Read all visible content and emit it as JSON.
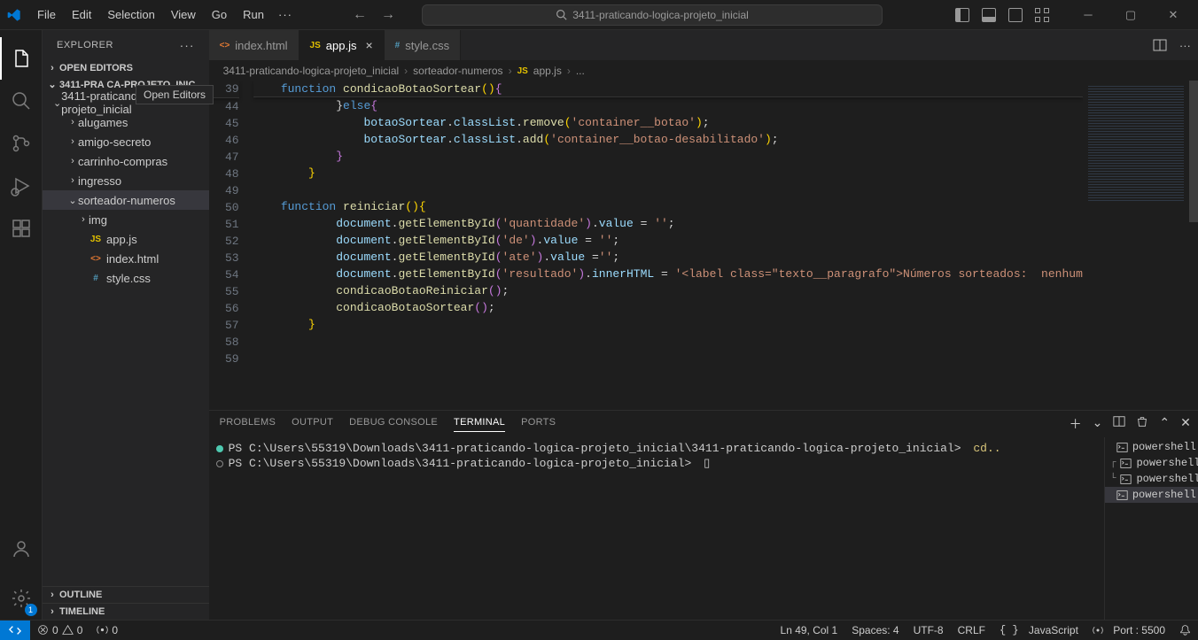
{
  "menubar": [
    "File",
    "Edit",
    "Selection",
    "View",
    "Go",
    "Run"
  ],
  "searchPlaceholder": "3411-praticando-logica-projeto_inicial",
  "explorerTitle": "EXPLORER",
  "sections": {
    "openEditors": "OPEN EDITORS",
    "outline": "OUTLINE",
    "timeline": "TIMELINE"
  },
  "tooltip": "Open Editors",
  "tree": {
    "root": "3411-PRA              CA-PROJETO_INIC...",
    "nodes": [
      {
        "depth": 1,
        "kind": "folder",
        "open": true,
        "label": "3411-praticando-logica-projeto_inicial"
      },
      {
        "depth": 2,
        "kind": "folder",
        "open": false,
        "label": "alugames"
      },
      {
        "depth": 2,
        "kind": "folder",
        "open": false,
        "label": "amigo-secreto"
      },
      {
        "depth": 2,
        "kind": "folder",
        "open": false,
        "label": "carrinho-compras"
      },
      {
        "depth": 2,
        "kind": "folder",
        "open": false,
        "label": "ingresso"
      },
      {
        "depth": 2,
        "kind": "folder",
        "open": true,
        "label": "sorteador-numeros",
        "selected": true
      },
      {
        "depth": 3,
        "kind": "folder",
        "open": false,
        "label": "img"
      },
      {
        "depth": 3,
        "kind": "file",
        "icon": "JS",
        "iconColor": "#e2c000",
        "label": "app.js"
      },
      {
        "depth": 3,
        "kind": "file",
        "icon": "<>",
        "iconColor": "#e37933",
        "label": "index.html"
      },
      {
        "depth": 3,
        "kind": "file",
        "icon": "#",
        "iconColor": "#519aba",
        "label": "style.css"
      }
    ]
  },
  "tabs": [
    {
      "icon": "<>",
      "iconColor": "#e37933",
      "label": "index.html",
      "active": false
    },
    {
      "icon": "JS",
      "iconColor": "#e2c000",
      "label": "app.js",
      "active": true,
      "close": true
    },
    {
      "icon": "#",
      "iconColor": "#519aba",
      "label": "style.css",
      "active": false
    }
  ],
  "breadcrumbs": [
    "3411-praticando-logica-projeto_inicial",
    "sorteador-numeros",
    "app.js",
    "..."
  ],
  "bcIcon": "JS",
  "codeStart": 39,
  "stickyLine": 39,
  "code": [
    [
      {
        "c": "k-blue",
        "t": "function "
      },
      {
        "c": "k-fn",
        "t": "condicaoBotaoSortear"
      },
      {
        "c": "k-brk",
        "t": "()"
      },
      {
        "c": "k-pnk",
        "t": "{"
      }
    ],
    [
      {
        "t": "        }"
      },
      {
        "c": "k-blue",
        "t": "else"
      },
      {
        "c": "k-pnk",
        "t": "{"
      }
    ],
    [
      {
        "t": "            "
      },
      {
        "c": "k-var",
        "t": "botaoSortear"
      },
      {
        "t": "."
      },
      {
        "c": "k-var",
        "t": "classList"
      },
      {
        "t": "."
      },
      {
        "c": "k-fn",
        "t": "remove"
      },
      {
        "c": "k-brk",
        "t": "("
      },
      {
        "c": "k-str",
        "t": "'container__botao'"
      },
      {
        "c": "k-brk",
        "t": ")"
      },
      {
        "t": ";"
      }
    ],
    [
      {
        "t": "            "
      },
      {
        "c": "k-var",
        "t": "botaoSortear"
      },
      {
        "t": "."
      },
      {
        "c": "k-var",
        "t": "classList"
      },
      {
        "t": "."
      },
      {
        "c": "k-fn",
        "t": "add"
      },
      {
        "c": "k-brk",
        "t": "("
      },
      {
        "c": "k-str",
        "t": "'container__botao-desabilitado'"
      },
      {
        "c": "k-brk",
        "t": ")"
      },
      {
        "t": ";"
      }
    ],
    [
      {
        "t": "        "
      },
      {
        "c": "k-pnk",
        "t": "}"
      }
    ],
    [
      {
        "t": "    "
      },
      {
        "c": "k-brk",
        "t": "}"
      }
    ],
    [
      {
        "t": ""
      }
    ],
    [
      {
        "c": "k-blue",
        "t": "function "
      },
      {
        "c": "k-fn",
        "t": "reiniciar"
      },
      {
        "c": "k-brk",
        "t": "()"
      },
      {
        "c": "k-brk",
        "t": "{"
      }
    ],
    [
      {
        "t": "        "
      },
      {
        "c": "k-var",
        "t": "document"
      },
      {
        "t": "."
      },
      {
        "c": "k-fn",
        "t": "getElementById"
      },
      {
        "c": "k-pnk",
        "t": "("
      },
      {
        "c": "k-str",
        "t": "'quantidade'"
      },
      {
        "c": "k-pnk",
        "t": ")"
      },
      {
        "t": "."
      },
      {
        "c": "k-var",
        "t": "value"
      },
      {
        "t": " = "
      },
      {
        "c": "k-str",
        "t": "''"
      },
      {
        "t": ";"
      }
    ],
    [
      {
        "t": "        "
      },
      {
        "c": "k-var",
        "t": "document"
      },
      {
        "t": "."
      },
      {
        "c": "k-fn",
        "t": "getElementById"
      },
      {
        "c": "k-pnk",
        "t": "("
      },
      {
        "c": "k-str",
        "t": "'de'"
      },
      {
        "c": "k-pnk",
        "t": ")"
      },
      {
        "t": "."
      },
      {
        "c": "k-var",
        "t": "value"
      },
      {
        "t": " = "
      },
      {
        "c": "k-str",
        "t": "''"
      },
      {
        "t": ";"
      }
    ],
    [
      {
        "t": "        "
      },
      {
        "c": "k-var",
        "t": "document"
      },
      {
        "t": "."
      },
      {
        "c": "k-fn",
        "t": "getElementById"
      },
      {
        "c": "k-pnk",
        "t": "("
      },
      {
        "c": "k-str",
        "t": "'ate'"
      },
      {
        "c": "k-pnk",
        "t": ")"
      },
      {
        "t": "."
      },
      {
        "c": "k-var",
        "t": "value"
      },
      {
        "t": " ="
      },
      {
        "c": "k-str",
        "t": "''"
      },
      {
        "t": ";"
      }
    ],
    [
      {
        "t": "        "
      },
      {
        "c": "k-var",
        "t": "document"
      },
      {
        "t": "."
      },
      {
        "c": "k-fn",
        "t": "getElementById"
      },
      {
        "c": "k-pnk",
        "t": "("
      },
      {
        "c": "k-str",
        "t": "'resultado'"
      },
      {
        "c": "k-pnk",
        "t": ")"
      },
      {
        "t": "."
      },
      {
        "c": "k-var",
        "t": "innerHTML"
      },
      {
        "t": " = "
      },
      {
        "c": "k-str",
        "t": "'<label class=\"texto__paragrafo\">Números sorteados:  nenhum"
      }
    ],
    [
      {
        "t": "        "
      },
      {
        "c": "k-fn",
        "t": "condicaoBotaoReiniciar"
      },
      {
        "c": "k-pnk",
        "t": "()"
      },
      {
        "t": ";"
      }
    ],
    [
      {
        "t": "        "
      },
      {
        "c": "k-fn",
        "t": "condicaoBotaoSortear"
      },
      {
        "c": "k-pnk",
        "t": "()"
      },
      {
        "t": ";"
      }
    ],
    [
      {
        "t": "    "
      },
      {
        "c": "k-brk",
        "t": "}"
      }
    ],
    [
      {
        "t": ""
      }
    ],
    [
      {
        "t": ""
      }
    ]
  ],
  "lineNumbers": [
    39,
    44,
    45,
    46,
    47,
    48,
    49,
    50,
    51,
    52,
    53,
    54,
    55,
    56,
    57,
    58,
    59
  ],
  "panelTabs": [
    {
      "l": "PROBLEMS"
    },
    {
      "l": "OUTPUT"
    },
    {
      "l": "DEBUG CONSOLE"
    },
    {
      "l": "TERMINAL",
      "active": true
    },
    {
      "l": "PORTS"
    }
  ],
  "terminalLines": [
    {
      "dot": 1,
      "text": "PS C:\\Users\\55319\\Downloads\\3411-praticando-logica-projeto_inicial\\3411-praticando-logica-projeto_inicial> ",
      "cmd": "cd.."
    },
    {
      "dot": 2,
      "text": "PS C:\\Users\\55319\\Downloads\\3411-praticando-logica-projeto_inicial> ",
      "cursor": true
    }
  ],
  "terminalSessions": [
    {
      "branch": "",
      "name": "powershell"
    },
    {
      "branch": "┌",
      "name": "powershell"
    },
    {
      "branch": "└",
      "name": "powershell"
    },
    {
      "branch": "",
      "name": "powershell",
      "active": true
    }
  ],
  "status": {
    "errors": "0",
    "warnings": "0",
    "radio": "0",
    "cursor": "Ln 49, Col 1",
    "spaces": "Spaces: 4",
    "enc": "UTF-8",
    "eol": "CRLF",
    "lang": "JavaScript",
    "port": "Port : 5500"
  }
}
